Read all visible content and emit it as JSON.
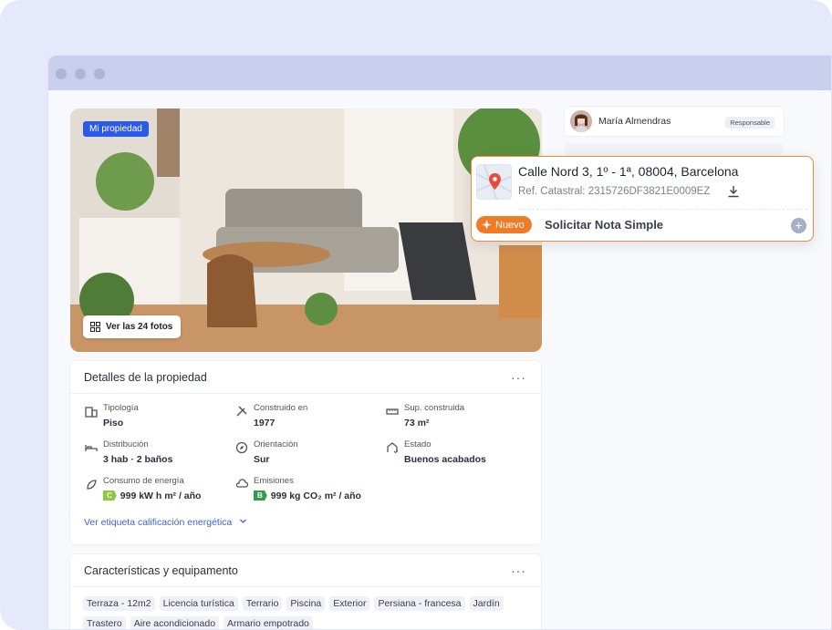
{
  "photo": {
    "tag": "Mi propiedad",
    "view_photos": "Ver las 24 fotos"
  },
  "details": {
    "title": "Detalles de la propiedad",
    "menu": "···",
    "items": [
      {
        "label": "Tipología",
        "value": "Piso",
        "icon": "building-icon"
      },
      {
        "label": "Construido en",
        "value": "1977",
        "icon": "tools-icon"
      },
      {
        "label": "Sup. construida",
        "value": "73 m²",
        "icon": "ruler-icon"
      },
      {
        "label": "Distribución",
        "value": "3 hab · 2 baños",
        "icon": "bed-icon"
      },
      {
        "label": "Orientación",
        "value": "Sur",
        "icon": "compass-icon"
      },
      {
        "label": "Estado",
        "value": "Buenos acabados",
        "icon": "house-check-icon"
      },
      {
        "label": "Consumo de energía",
        "value": "999 kW h m² / año",
        "badge": "C",
        "badge_color": "#8dc63f",
        "icon": "energy-leaf-icon"
      },
      {
        "label": "Emisiones",
        "value": "999 kg CO₂ m² / año",
        "badge": "B",
        "badge_color": "#2e9e4a",
        "icon": "cloud-icon"
      }
    ],
    "link": "Ver etiqueta calificación energética"
  },
  "features": {
    "title": "Características y equipamento",
    "menu": "···",
    "chips": [
      "Terraza - 12m2",
      "Licencia turística",
      "Terrario",
      "Piscina",
      "Exterior",
      "Persiana - francesa",
      "Jardín",
      "Trastero",
      "Aire acondicionado",
      "Armario empotrado"
    ]
  },
  "responsible": {
    "name": "María Almendras",
    "role": "Responsable"
  },
  "popup": {
    "address": "Calle Nord 3, 1º - 1ª, 08004, Barcelona",
    "ref": "Ref. Catastral: 2315726DF3821E0009EZ",
    "new_badge": "Nuevo",
    "action": "Solicitar Nota Simple",
    "plus": "+"
  },
  "colors": {
    "accent_orange": "#f27a26",
    "accent_blue": "#2c5ae8",
    "link_blue": "#3d62d8"
  }
}
